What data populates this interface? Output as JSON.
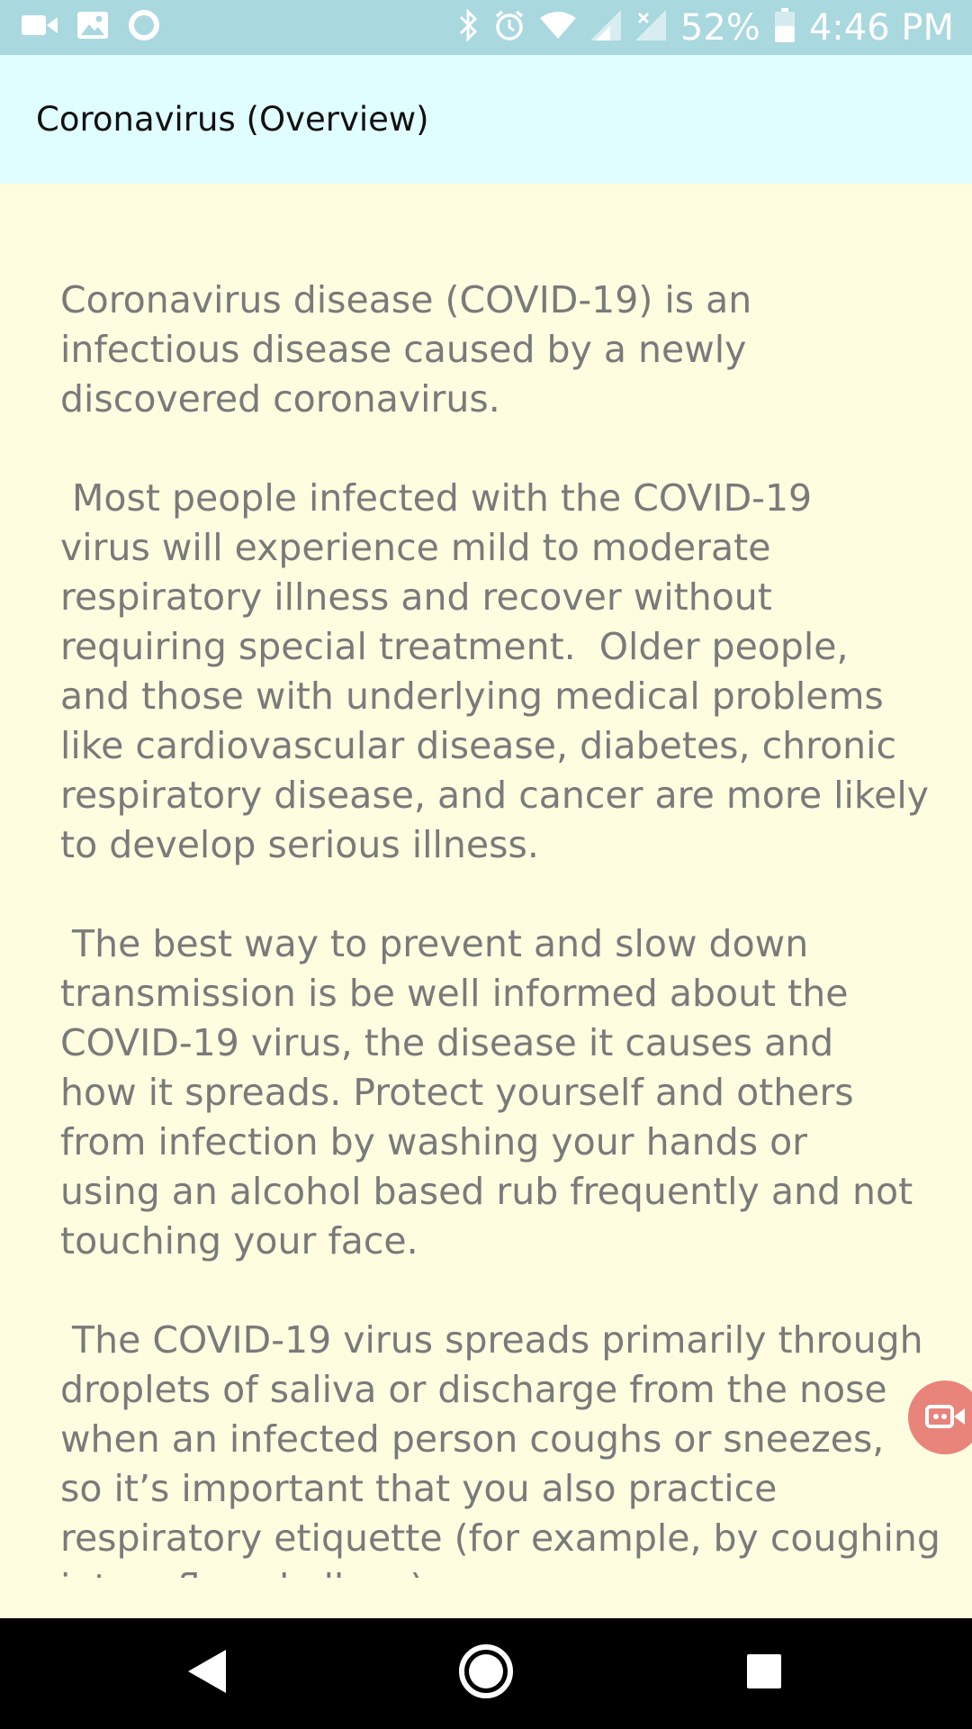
{
  "status_bar": {
    "battery_percent": "52%",
    "time": "4:46 PM",
    "left_icons": [
      "video-camera-icon",
      "image-icon",
      "circle-notification-icon"
    ],
    "right_icons": [
      "bluetooth-icon",
      "alarm-icon",
      "wifi-icon",
      "signal-icon",
      "signal-no-service-icon",
      "battery-icon"
    ]
  },
  "app_bar": {
    "title": "Coronavirus (Overview)"
  },
  "content": {
    "body": "Coronavirus disease (COVID-19) is an\ninfectious disease caused by a newly\ndiscovered coronavirus.\n\n Most people infected with the COVID-19\nvirus will experience mild to moderate\nrespiratory illness and recover without\nrequiring special treatment.  Older people,\nand those with underlying medical problems\nlike cardiovascular disease, diabetes, chronic\nrespiratory disease, and cancer are more likely\nto develop serious illness.\n\n The best way to prevent and slow down\ntransmission is be well informed about the\nCOVID-19 virus, the disease it causes and\nhow it spreads. Protect yourself and others\nfrom infection by washing your hands or\nusing an alcohol based rub frequently and not\ntouching your face.\n\n The COVID-19 virus spreads primarily through\ndroplets of saliva or discharge from the nose\nwhen an infected person coughs or sneezes,\nso it’s important that you also practice\nrespiratory etiquette (for example, by coughing\ninto a flexed elbow)."
  },
  "floating_button": {
    "icon": "video-call-icon",
    "color": "#e8847a"
  },
  "nav_bar": {
    "buttons": [
      "back-icon",
      "home-icon",
      "recents-icon"
    ]
  },
  "colors": {
    "status_bar": "#a9d8df",
    "app_bar": "#e0feff",
    "background": "#fffde0",
    "body_text": "#7a7a7a"
  }
}
